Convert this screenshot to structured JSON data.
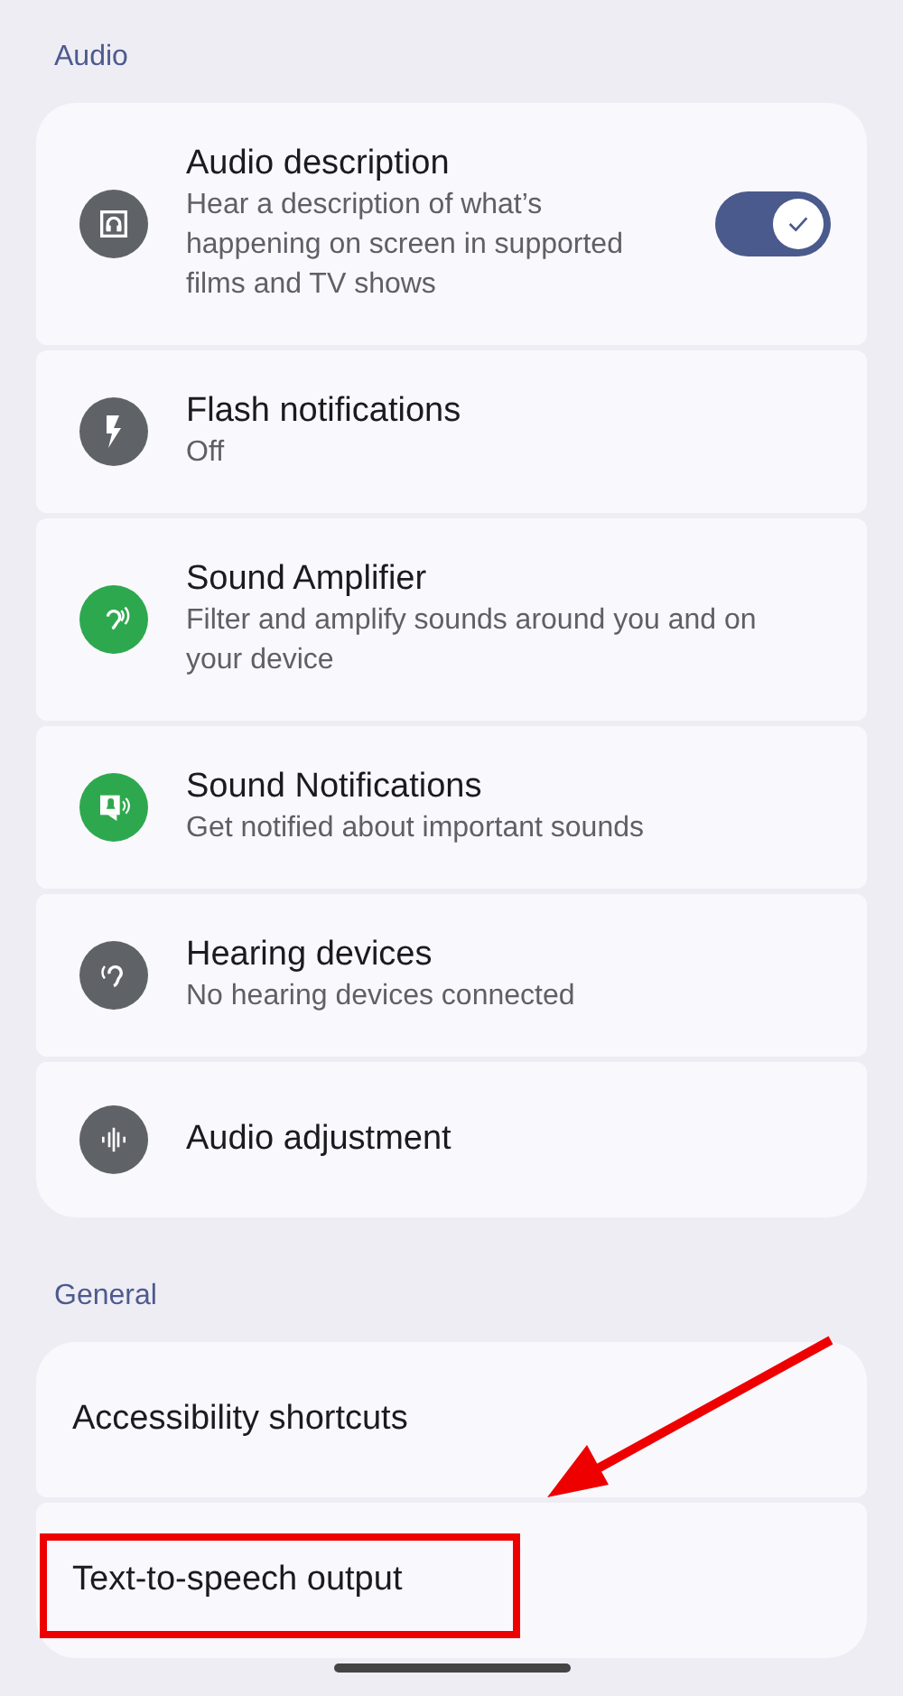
{
  "sections": [
    {
      "title": "Audio",
      "items": [
        {
          "title": "Audio description",
          "subtitle": "Hear a description of what’s happening on screen in supported films and TV shows",
          "color": "#5f6368",
          "on": true
        },
        {
          "title": "Flash notifications",
          "subtitle": "Off",
          "color": "#5f6368"
        },
        {
          "title": "Sound Amplifier",
          "subtitle": "Filter and amplify sounds around you and on your device",
          "color": "#2ea84e"
        },
        {
          "title": "Sound Notifications",
          "subtitle": "Get notified about important sounds",
          "color": "#2ea84e"
        },
        {
          "title": "Hearing devices",
          "subtitle": "No hearing devices connected",
          "color": "#5f6368"
        },
        {
          "title": "Audio adjustment",
          "color": "#5f6368"
        }
      ]
    },
    {
      "title": "General",
      "items": [
        {
          "title": "Accessibility shortcuts",
          "highlighted": false
        },
        {
          "title": "Text-to-speech output",
          "highlighted": true
        }
      ]
    }
  ]
}
